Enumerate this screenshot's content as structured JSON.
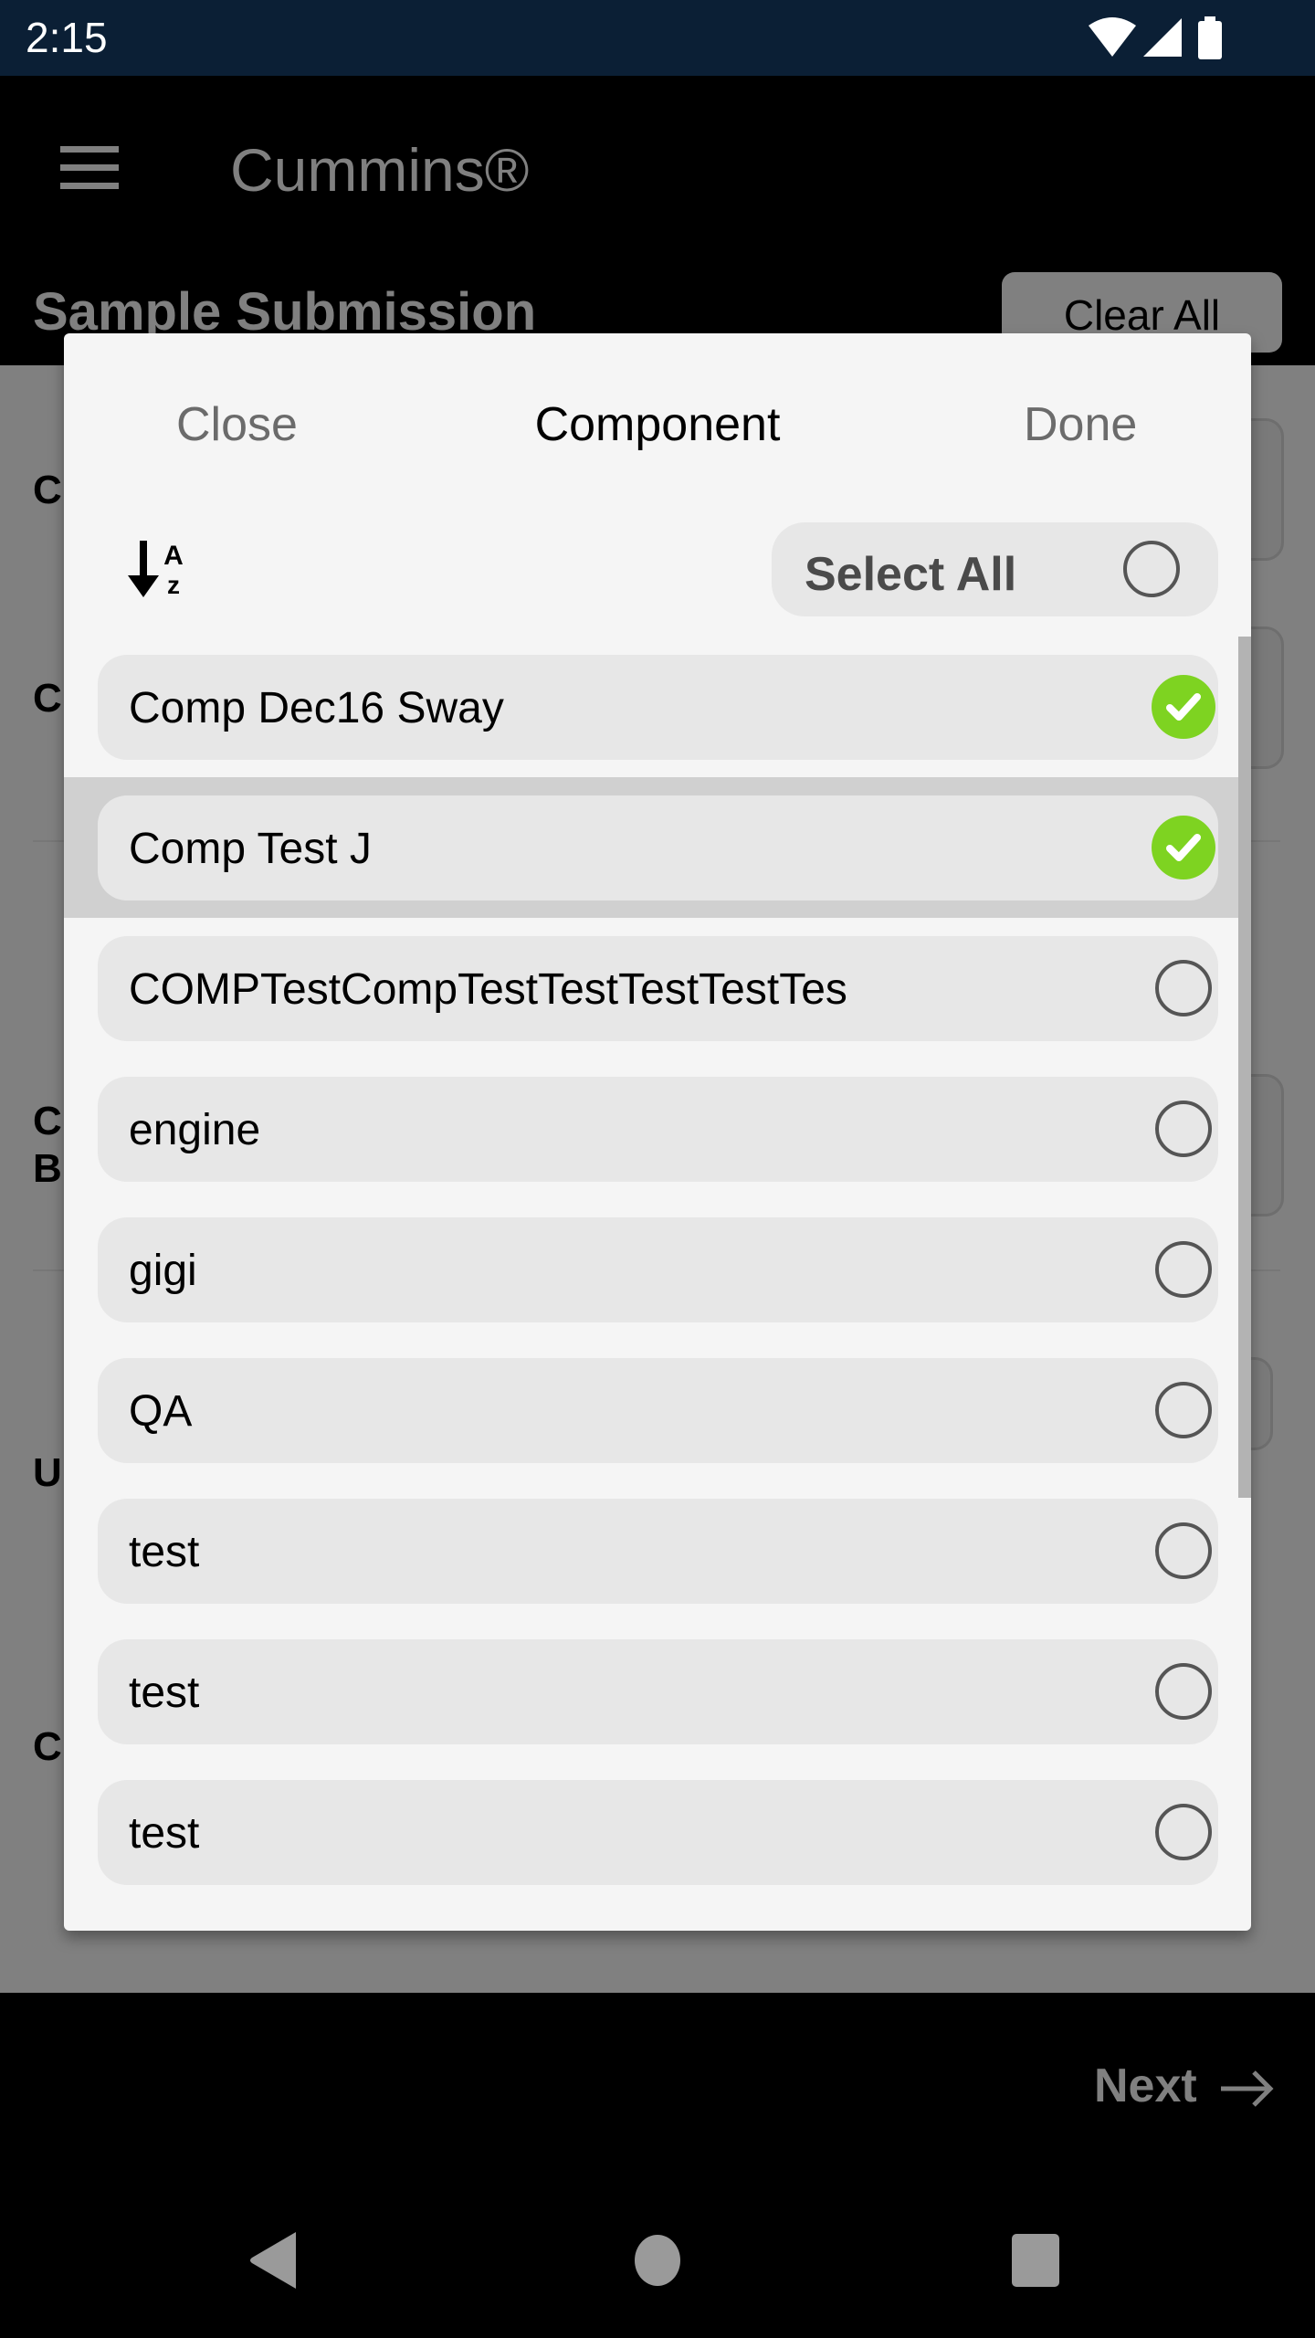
{
  "status_bar": {
    "time": "2:15",
    "icons": [
      "wifi-icon",
      "signal-icon",
      "battery-icon"
    ]
  },
  "app_bar": {
    "menu_icon": "hamburger-icon",
    "title": "Cummins®"
  },
  "page": {
    "title": "Sample Submission",
    "clear_all_label": "Clear All",
    "background_labels": [
      "C",
      "C",
      "C\nB",
      "U",
      "C"
    ],
    "next_label": "Next",
    "next_icon": "arrow-right-icon"
  },
  "modal": {
    "close_label": "Close",
    "title": "Component",
    "done_label": "Done",
    "sort_icon": "sort-alpha-down-icon",
    "sort_glyph_top": "A",
    "sort_glyph_bottom": "z",
    "select_all_label": "Select All",
    "select_all_checked": false,
    "items": [
      {
        "label": "Comp Dec16 Sway",
        "checked": true
      },
      {
        "label": "Comp Test J",
        "checked": true,
        "highlighted": true
      },
      {
        "label": "COMPTestCompTestTestTestTestTes",
        "checked": false
      },
      {
        "label": "engine",
        "checked": false
      },
      {
        "label": "gigi",
        "checked": false
      },
      {
        "label": "QA",
        "checked": false
      },
      {
        "label": "test",
        "checked": false
      },
      {
        "label": "test",
        "checked": false
      },
      {
        "label": "test",
        "checked": false
      }
    ]
  },
  "colors": {
    "status_bar": "#0b1f35",
    "checked": "#7ed321",
    "overlay": "#808080",
    "modal_bg": "#f5f5f5",
    "row_bg": "#e7e7e7",
    "highlight": "#d0d0d0"
  },
  "nav_bar": {
    "back_icon": "back-icon",
    "home_icon": "home-icon",
    "recents_icon": "recents-icon"
  }
}
